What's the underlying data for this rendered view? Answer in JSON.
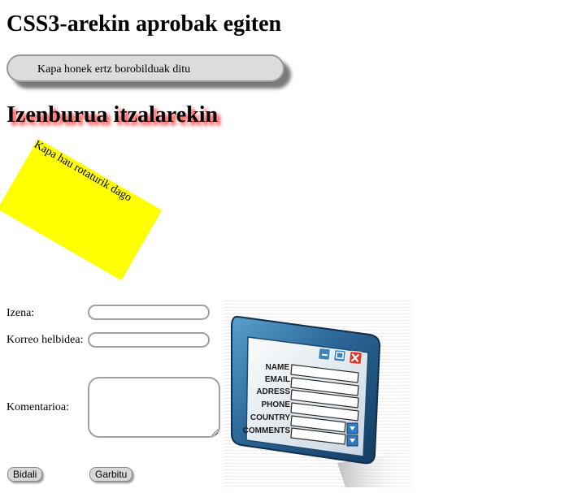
{
  "page": {
    "title": "CSS3-arekin aprobak egiten",
    "rounded_box_text": "Kapa honek ertz borobilduak ditu",
    "shadow_heading": "Izenburua itzalarekin",
    "rotated_box_text": "Kapa hau rotaturik dago"
  },
  "form": {
    "name_label": "Izena:",
    "name_value": "",
    "email_label": "Korreo helbidea:",
    "email_value": "",
    "comments_label": "Komentarioa:",
    "comments_value": "",
    "submit_label": "Bidali",
    "reset_label": "Garbitu"
  },
  "illustration": {
    "icon": "form-window-icon",
    "fields": [
      "NAME",
      "EMAIL",
      "ADRESS",
      "PHONE",
      "COUNTRY",
      "COMMENTS"
    ]
  },
  "colors": {
    "rotated_box": "#ffff00",
    "heading_shadow": "#ff2a2a",
    "window_blue": "#2f6d9e",
    "window_close": "#d8392b"
  }
}
